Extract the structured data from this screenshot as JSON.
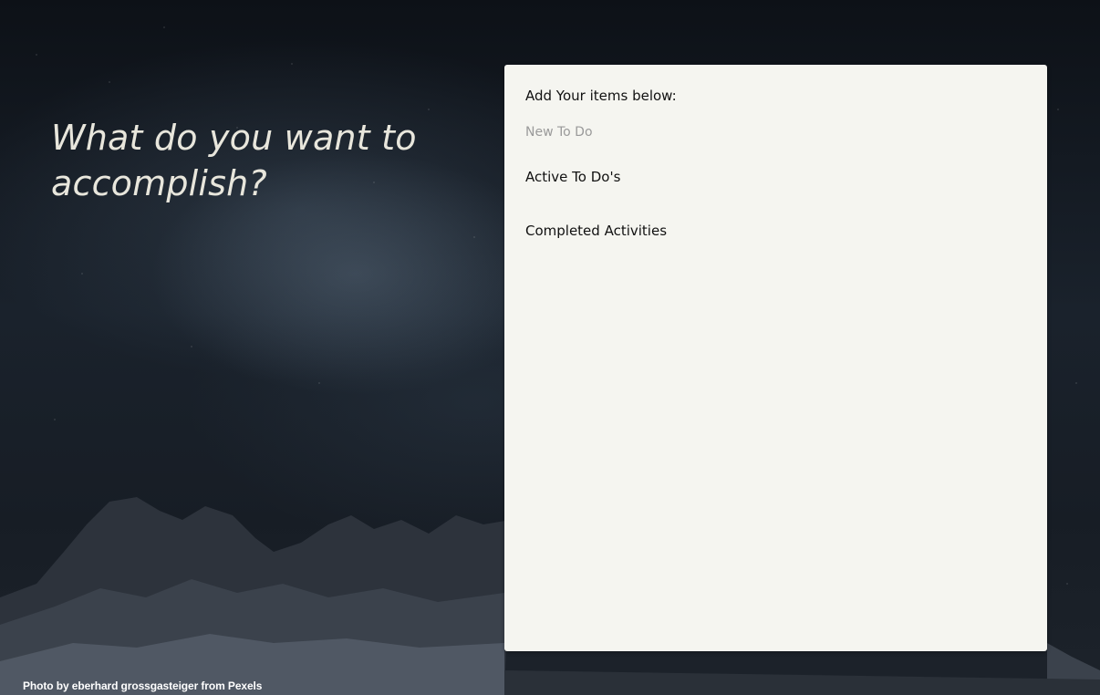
{
  "headline": "What do you want to accomplish?",
  "panel": {
    "add_label": "Add Your items below:",
    "input": {
      "placeholder": "New To Do",
      "value": ""
    },
    "active_label": "Active To Do's",
    "active_items": [],
    "completed_label": "Completed Activities",
    "completed_items": []
  },
  "credit": "Photo by eberhard grossgasteiger from Pexels",
  "colors": {
    "panel_bg": "#f5f5f0",
    "headline_text": "#e8e6dc",
    "placeholder_text": "#9a9a9a"
  }
}
